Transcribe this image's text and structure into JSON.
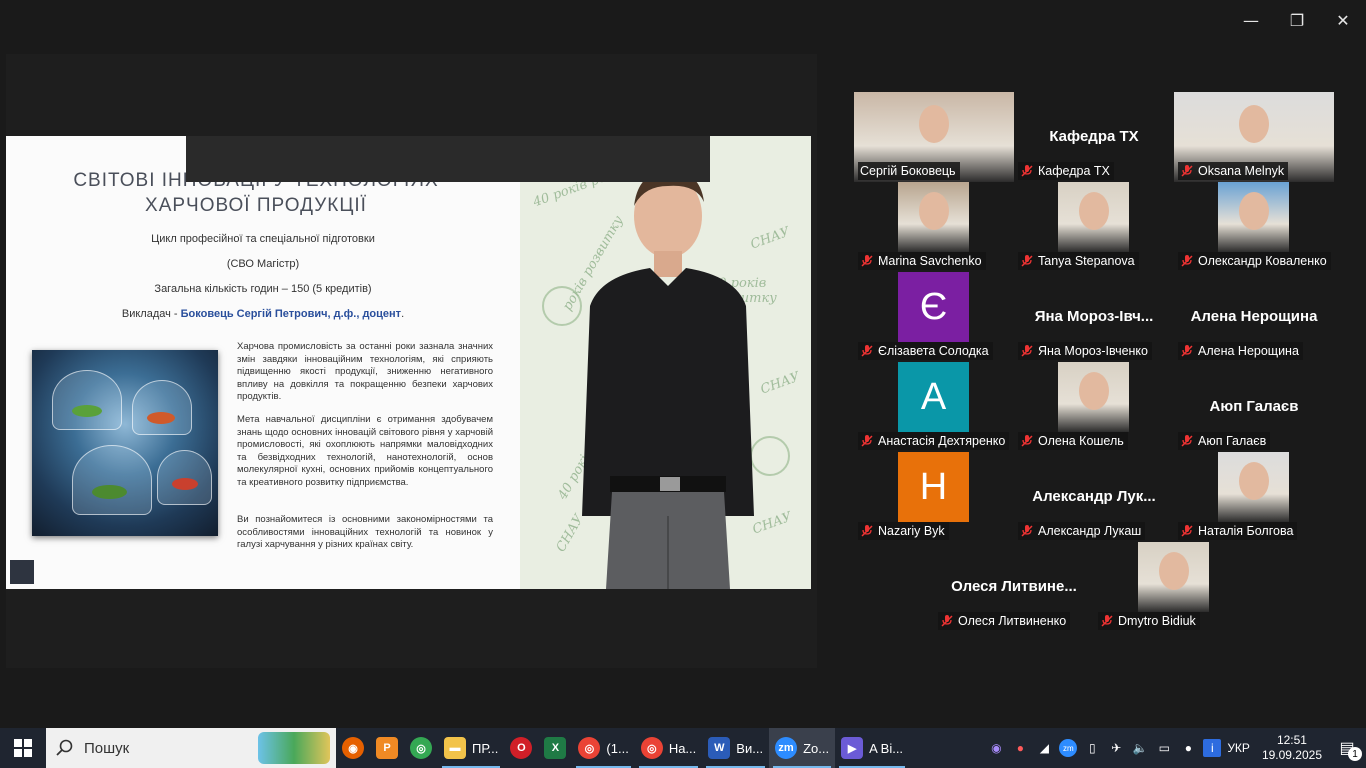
{
  "window": {
    "controls": [
      "—",
      "❐",
      "✕"
    ]
  },
  "slide": {
    "title_line1": "СВІТОВІ ІННОВАЦІЇ У ТЕХНОЛОГІЯХ",
    "title_line2": "ХАРЧОВОЇ ПРОДУКЦІЇ",
    "cycle": "Цикл професійної та спеціальної підготовки",
    "level": "(СВО Магістр)",
    "hours": "Загальна кількість годин – 150 (5 кредитів)",
    "teacher_prefix": "Викладач -",
    "teacher_name": "Боковець Сергій Петрович, д.ф., доцент",
    "teacher_suffix": ".",
    "para1": "Харчова промисловість за останні роки зазнала значних змін завдяки інноваційним технологіям, які сприяють підвищенню якості продукції, зниженню негативного впливу на довкілля та покращенню безпеки харчових продуктів.",
    "para2": "Мета навчальної дисципліни є отримання здобувачем знань щодо основних інновацій світового рівня у харчовій промисловості, які охоплюють напрямки маловідходних та безвідходних технологій, нанотехнологій, основ молекулярної кухні, основних прийомів концептуального та креативного розвитку підприємства.",
    "para3": "Ви познайомитеся із основними закономірностями та особливостями інноваційних технологій та новинок у галузі харчування у різних країнах світу.",
    "banner_words": [
      "СНАУ",
      "40 років розвитку",
      "СНАУ",
      "40 років розвитку",
      "СНАУ",
      "років розвитку",
      "СНАУ",
      "40 років розвитку"
    ]
  },
  "participants": [
    {
      "name": "Сергій Боковець",
      "type": "video",
      "active": true,
      "muted": false
    },
    {
      "name": "Кафедра ТХ",
      "type": "name",
      "big": "Кафедра ТХ",
      "muted": true
    },
    {
      "name": "Oksana Melnyk",
      "type": "video",
      "muted": true
    },
    {
      "name": "Marina Savchenko",
      "type": "photo",
      "muted": true
    },
    {
      "name": "Tanya Stepanova",
      "type": "photo",
      "muted": true
    },
    {
      "name": "Олександр Коваленко",
      "type": "photo",
      "muted": true
    },
    {
      "name": "Єлізавета Солодка",
      "type": "letter",
      "letter": "Є",
      "color": "#7b1fa2",
      "muted": true
    },
    {
      "name": "Яна Мороз-Івченко",
      "type": "name",
      "big": "Яна  Мороз-Івч...",
      "muted": true
    },
    {
      "name": "Алена Нерощина",
      "type": "name",
      "big": "Алена Нерощина",
      "muted": true
    },
    {
      "name": "Анастасія Дехтяренко",
      "type": "letter",
      "letter": "А",
      "color": "#0a97a8",
      "muted": true
    },
    {
      "name": "Олена Кошель",
      "type": "photo",
      "muted": true
    },
    {
      "name": "Аюп Галаєв",
      "type": "name",
      "big": "Аюп Галаєв",
      "muted": true
    },
    {
      "name": "Nazariy Byk",
      "type": "letter",
      "letter": "H",
      "color": "#e8710a",
      "muted": true
    },
    {
      "name": "Александр Лукаш",
      "type": "name",
      "big": "Александр  Лук...",
      "muted": true
    },
    {
      "name": "Наталія Болгова",
      "type": "photo",
      "muted": true
    },
    {
      "name": "Олеся Литвиненко",
      "type": "name",
      "big": "Олеся  Литвине...",
      "muted": true
    },
    {
      "name": "Dmytro Bidiuk",
      "type": "photo",
      "muted": true
    }
  ],
  "taskbar": {
    "search_label": "Пошук",
    "apps": [
      {
        "icon": "firefox-icon",
        "label": ""
      },
      {
        "icon": "pdf-app-icon",
        "label": ""
      },
      {
        "icon": "chrome-icon",
        "label": ""
      },
      {
        "icon": "file-explorer-icon",
        "label": "ПР..."
      },
      {
        "icon": "opera-icon",
        "label": ""
      },
      {
        "icon": "excel-icon",
        "label": ""
      },
      {
        "icon": "chrome-profile-icon",
        "label": "(1..."
      },
      {
        "icon": "chrome-profile-k-icon",
        "label": "На..."
      },
      {
        "icon": "word-icon",
        "label": "Ви..."
      },
      {
        "icon": "zoom-icon",
        "label": "Zo..."
      },
      {
        "icon": "media-player-icon",
        "label": "A Ві..."
      }
    ],
    "language": "УКР",
    "time": "12:51",
    "date": "19.09.2025",
    "notifications": "1"
  }
}
